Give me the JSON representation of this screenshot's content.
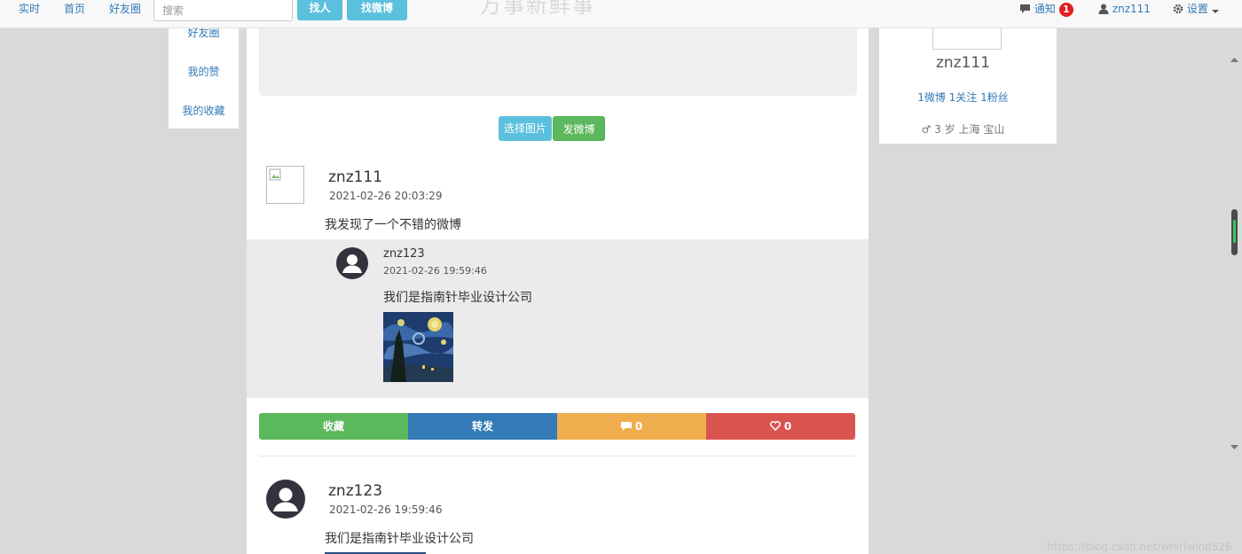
{
  "nav": {
    "links": [
      "实时",
      "首页",
      "好友圈"
    ],
    "search_placeholder": "搜索",
    "find_people": "找人",
    "find_weibo": "找微博",
    "site_title": "万事新鲜事",
    "notify_label": "通知",
    "notify_count": "1",
    "username": "znz111",
    "settings_label": "设置"
  },
  "sidebar": {
    "items": [
      "好友圈",
      "我的赞",
      "我的收藏"
    ]
  },
  "composer": {
    "choose_image": "选择图片",
    "post": "发微博"
  },
  "post1": {
    "author": "znz111",
    "time": "2021-02-26 20:03:29",
    "content": "我发现了一个不错的微博",
    "repost": {
      "author": "znz123",
      "time": "2021-02-26 19:59:46",
      "content": "我们是指南针毕业设计公司"
    },
    "actions": {
      "favorite": "收藏",
      "forward": "转发",
      "comments": "0",
      "likes": "0"
    }
  },
  "post2": {
    "author": "znz123",
    "time": "2021-02-26 19:59:46",
    "content": "我们是指南针毕业设计公司"
  },
  "profile": {
    "username": "znz111",
    "stats": "1微博 1关注 1粉丝",
    "info": "3 岁 上海 宝山"
  },
  "watermark": "https://blog.csdn.net/whirlwind526",
  "colors": {
    "green": "#5cb85c",
    "blue": "#337ab7",
    "orange": "#f0ad4e",
    "red": "#d9534f",
    "info": "#5bc0de"
  }
}
